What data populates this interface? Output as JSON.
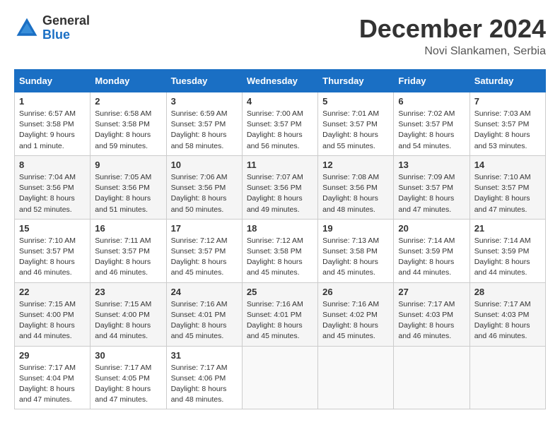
{
  "header": {
    "logo_general": "General",
    "logo_blue": "Blue",
    "month_title": "December 2024",
    "location": "Novi Slankamen, Serbia"
  },
  "calendar": {
    "days_of_week": [
      "Sunday",
      "Monday",
      "Tuesday",
      "Wednesday",
      "Thursday",
      "Friday",
      "Saturday"
    ],
    "weeks": [
      [
        null,
        {
          "day": "2",
          "sunrise": "Sunrise: 6:58 AM",
          "sunset": "Sunset: 3:58 PM",
          "daylight": "Daylight: 8 hours and 59 minutes."
        },
        {
          "day": "3",
          "sunrise": "Sunrise: 6:59 AM",
          "sunset": "Sunset: 3:57 PM",
          "daylight": "Daylight: 8 hours and 58 minutes."
        },
        {
          "day": "4",
          "sunrise": "Sunrise: 7:00 AM",
          "sunset": "Sunset: 3:57 PM",
          "daylight": "Daylight: 8 hours and 56 minutes."
        },
        {
          "day": "5",
          "sunrise": "Sunrise: 7:01 AM",
          "sunset": "Sunset: 3:57 PM",
          "daylight": "Daylight: 8 hours and 55 minutes."
        },
        {
          "day": "6",
          "sunrise": "Sunrise: 7:02 AM",
          "sunset": "Sunset: 3:57 PM",
          "daylight": "Daylight: 8 hours and 54 minutes."
        },
        {
          "day": "7",
          "sunrise": "Sunrise: 7:03 AM",
          "sunset": "Sunset: 3:57 PM",
          "daylight": "Daylight: 8 hours and 53 minutes."
        }
      ],
      [
        {
          "day": "1",
          "sunrise": "Sunrise: 6:57 AM",
          "sunset": "Sunset: 3:58 PM",
          "daylight": "Daylight: 9 hours and 1 minute."
        },
        {
          "day": "9",
          "sunrise": "Sunrise: 7:05 AM",
          "sunset": "Sunset: 3:56 PM",
          "daylight": "Daylight: 8 hours and 51 minutes."
        },
        {
          "day": "10",
          "sunrise": "Sunrise: 7:06 AM",
          "sunset": "Sunset: 3:56 PM",
          "daylight": "Daylight: 8 hours and 50 minutes."
        },
        {
          "day": "11",
          "sunrise": "Sunrise: 7:07 AM",
          "sunset": "Sunset: 3:56 PM",
          "daylight": "Daylight: 8 hours and 49 minutes."
        },
        {
          "day": "12",
          "sunrise": "Sunrise: 7:08 AM",
          "sunset": "Sunset: 3:56 PM",
          "daylight": "Daylight: 8 hours and 48 minutes."
        },
        {
          "day": "13",
          "sunrise": "Sunrise: 7:09 AM",
          "sunset": "Sunset: 3:57 PM",
          "daylight": "Daylight: 8 hours and 47 minutes."
        },
        {
          "day": "14",
          "sunrise": "Sunrise: 7:10 AM",
          "sunset": "Sunset: 3:57 PM",
          "daylight": "Daylight: 8 hours and 47 minutes."
        }
      ],
      [
        {
          "day": "8",
          "sunrise": "Sunrise: 7:04 AM",
          "sunset": "Sunset: 3:56 PM",
          "daylight": "Daylight: 8 hours and 52 minutes."
        },
        {
          "day": "16",
          "sunrise": "Sunrise: 7:11 AM",
          "sunset": "Sunset: 3:57 PM",
          "daylight": "Daylight: 8 hours and 46 minutes."
        },
        {
          "day": "17",
          "sunrise": "Sunrise: 7:12 AM",
          "sunset": "Sunset: 3:57 PM",
          "daylight": "Daylight: 8 hours and 45 minutes."
        },
        {
          "day": "18",
          "sunrise": "Sunrise: 7:12 AM",
          "sunset": "Sunset: 3:58 PM",
          "daylight": "Daylight: 8 hours and 45 minutes."
        },
        {
          "day": "19",
          "sunrise": "Sunrise: 7:13 AM",
          "sunset": "Sunset: 3:58 PM",
          "daylight": "Daylight: 8 hours and 45 minutes."
        },
        {
          "day": "20",
          "sunrise": "Sunrise: 7:14 AM",
          "sunset": "Sunset: 3:59 PM",
          "daylight": "Daylight: 8 hours and 44 minutes."
        },
        {
          "day": "21",
          "sunrise": "Sunrise: 7:14 AM",
          "sunset": "Sunset: 3:59 PM",
          "daylight": "Daylight: 8 hours and 44 minutes."
        }
      ],
      [
        {
          "day": "15",
          "sunrise": "Sunrise: 7:10 AM",
          "sunset": "Sunset: 3:57 PM",
          "daylight": "Daylight: 8 hours and 46 minutes."
        },
        {
          "day": "23",
          "sunrise": "Sunrise: 7:15 AM",
          "sunset": "Sunset: 4:00 PM",
          "daylight": "Daylight: 8 hours and 44 minutes."
        },
        {
          "day": "24",
          "sunrise": "Sunrise: 7:16 AM",
          "sunset": "Sunset: 4:01 PM",
          "daylight": "Daylight: 8 hours and 45 minutes."
        },
        {
          "day": "25",
          "sunrise": "Sunrise: 7:16 AM",
          "sunset": "Sunset: 4:01 PM",
          "daylight": "Daylight: 8 hours and 45 minutes."
        },
        {
          "day": "26",
          "sunrise": "Sunrise: 7:16 AM",
          "sunset": "Sunset: 4:02 PM",
          "daylight": "Daylight: 8 hours and 45 minutes."
        },
        {
          "day": "27",
          "sunrise": "Sunrise: 7:17 AM",
          "sunset": "Sunset: 4:03 PM",
          "daylight": "Daylight: 8 hours and 46 minutes."
        },
        {
          "day": "28",
          "sunrise": "Sunrise: 7:17 AM",
          "sunset": "Sunset: 4:03 PM",
          "daylight": "Daylight: 8 hours and 46 minutes."
        }
      ],
      [
        {
          "day": "22",
          "sunrise": "Sunrise: 7:15 AM",
          "sunset": "Sunset: 4:00 PM",
          "daylight": "Daylight: 8 hours and 44 minutes."
        },
        {
          "day": "30",
          "sunrise": "Sunrise: 7:17 AM",
          "sunset": "Sunset: 4:05 PM",
          "daylight": "Daylight: 8 hours and 47 minutes."
        },
        {
          "day": "31",
          "sunrise": "Sunrise: 7:17 AM",
          "sunset": "Sunset: 4:06 PM",
          "daylight": "Daylight: 8 hours and 48 minutes."
        },
        null,
        null,
        null,
        null
      ],
      [
        {
          "day": "29",
          "sunrise": "Sunrise: 7:17 AM",
          "sunset": "Sunset: 4:04 PM",
          "daylight": "Daylight: 8 hours and 47 minutes."
        },
        null,
        null,
        null,
        null,
        null,
        null
      ]
    ]
  }
}
